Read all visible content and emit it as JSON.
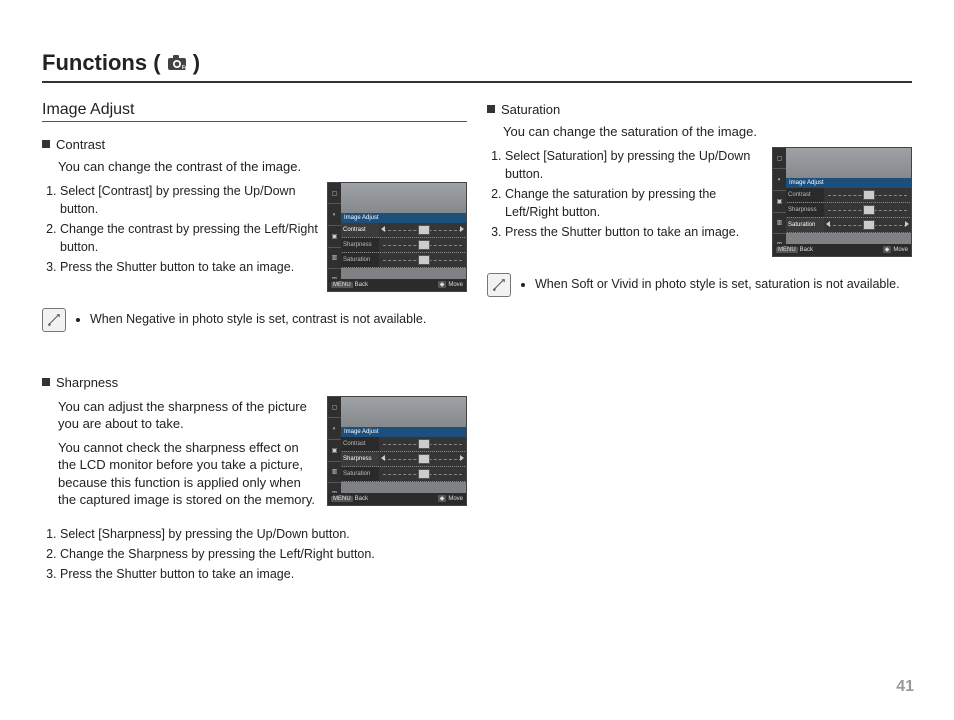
{
  "title_prefix": "Functions ( ",
  "title_suffix": " )",
  "page_number": "41",
  "section_heading": "Image Adjust",
  "camera_ui": {
    "header": "Image Adjust",
    "rows": [
      "Contrast",
      "Sharpness",
      "Saturation"
    ],
    "footer": {
      "back_btn": "MENU",
      "back": "Back",
      "move_btn": "◆",
      "move": "Move"
    }
  },
  "contrast": {
    "title": "Contrast",
    "desc": "You can change the contrast of the image.",
    "steps": [
      "Select [Contrast] by pressing the Up/Down button.",
      "Change the contrast by pressing the Left/Right button.",
      "Press the Shutter button to take an image."
    ],
    "note": "When Negative in photo style is set, contrast is not available."
  },
  "sharpness": {
    "title": "Sharpness",
    "desc1": "You can adjust the sharpness of the picture you are about to take.",
    "desc2": "You cannot check the sharpness effect on the LCD monitor before you take a picture, because this function is applied only when the captured image is stored on the memory.",
    "steps": [
      "Select [Sharpness] by pressing the Up/Down button.",
      "Change the Sharpness by pressing the Left/Right button.",
      "Press the Shutter button to take an image."
    ]
  },
  "saturation": {
    "title": "Saturation",
    "desc": "You can change the saturation of the image.",
    "steps": [
      "Select [Saturation] by pressing the Up/Down button.",
      "Change the saturation by pressing the Left/Right button.",
      "Press the Shutter button to take an image."
    ],
    "note": "When Soft or Vivid in photo style is set, saturation is not available."
  }
}
